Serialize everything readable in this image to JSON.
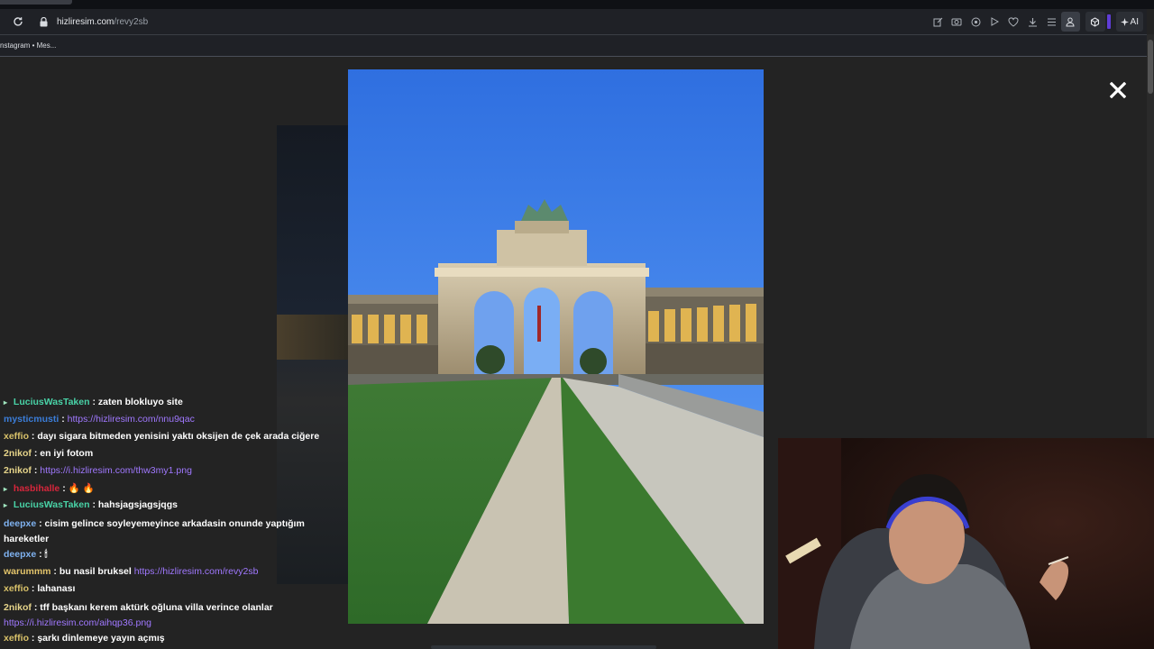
{
  "browser": {
    "url_host": "hizliresim.com",
    "url_path": "/revy2sb",
    "bookmark_label": "nstagram • Mes...",
    "ai_label": "AI",
    "toolbar_icons": [
      "edit-icon",
      "camera-icon",
      "shield-icon",
      "play-icon",
      "heart-icon",
      "download-icon",
      "menu-icon",
      "profile-icon"
    ]
  },
  "viewer": {
    "close_symbol": "✕"
  },
  "chat": {
    "messages": [
      {
        "user": "LuciusWasTaken",
        "color": "#49d3a7",
        "badge": "▸",
        "text": " : zaten blokluyo site",
        "link": ""
      },
      {
        "user": "mysticmusti",
        "color": "#3b7dd8",
        "badge": "",
        "text": " : ",
        "link": "https://hizliresim.com/nnu9qac"
      },
      {
        "user": "xeffio",
        "color": "#d8c169",
        "badge": "",
        "text": " : dayı sigara bitmeden yenisini yaktı oksijen de çek arada ciğere",
        "link": ""
      },
      {
        "user": "2nikof",
        "color": "#e6d48a",
        "badge": "",
        "text": " : en iyi fotom",
        "link": ""
      },
      {
        "user": "2nikof",
        "color": "#e6d48a",
        "badge": "",
        "text": " : ",
        "link": "https://i.hizliresim.com/thw3my1.png"
      },
      {
        "user": "hasbihalle",
        "color": "#d8263c",
        "badge": "▸",
        "text": " : 🔥 🔥",
        "link": ""
      },
      {
        "user": "LuciusWasTaken",
        "color": "#49d3a7",
        "badge": "▸",
        "text": " : hahsjagsjagsjqgs",
        "link": ""
      },
      {
        "user": "deepxe",
        "color": "#7fb2f0",
        "badge": "",
        "text": " : cisim gelince soyleyemeyince arkadasin onunde yaptığım hareketler",
        "link": ""
      },
      {
        "user": "deepxe",
        "color": "#7fb2f0",
        "badge": "",
        "text": " : 🕯",
        "link": ""
      },
      {
        "user": "warummm",
        "color": "#e3c46b",
        "badge": "",
        "text": " : bu nasil bruksel ",
        "link": "https://hizliresim.com/revy2sb"
      },
      {
        "user": "xeffio",
        "color": "#d8c169",
        "badge": "",
        "text": " : lahanası",
        "link": ""
      },
      {
        "user": "2nikof",
        "color": "#e6d48a",
        "badge": "",
        "text": " : tff başkanı kerem aktürk oğluna villa verince olanlar",
        "link": "https://i.hizliresim.com/aihqp36.png"
      },
      {
        "user": "xeffio",
        "color": "#d8c169",
        "badge": "",
        "text": " : şarkı dinlemeye yayın açmış",
        "link": ""
      }
    ]
  },
  "colors": {
    "background": "#232323",
    "browser_bar": "#1f2126",
    "link": "#a078ff",
    "sky_top": "#2f6fe0",
    "grass": "#3a7a2f"
  }
}
